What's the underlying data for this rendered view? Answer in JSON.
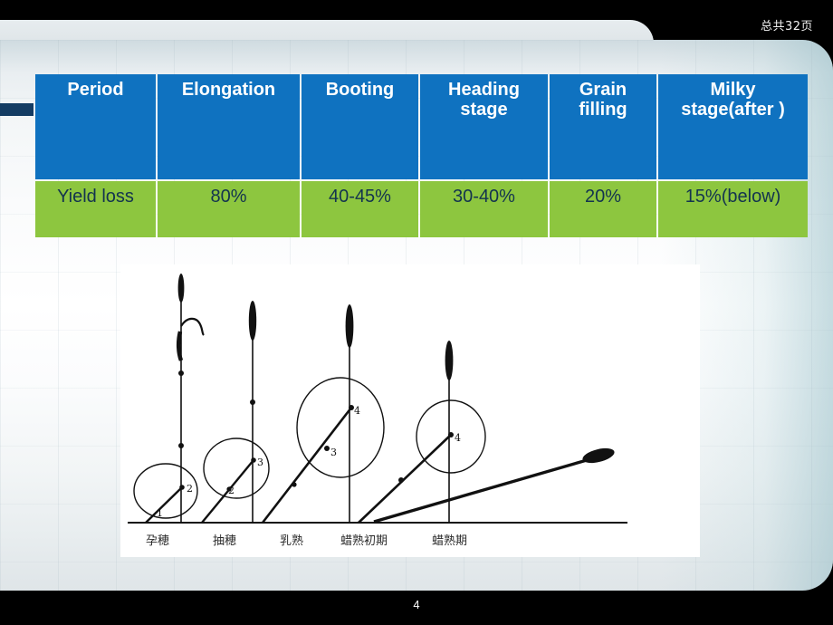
{
  "slide": {
    "page_counter": "总共32页",
    "page_number": "4",
    "accent_color": "#143c63",
    "header_color": "#0f72c0",
    "row_color": "#8dc63f",
    "row_text_color": "#13334f"
  },
  "table": {
    "headers": [
      "Period",
      "Elongation",
      "Booting",
      "Heading stage",
      "Grain filling",
      "Milky stage(after )"
    ],
    "rows": [
      {
        "label": "Yield loss",
        "values": [
          "80%",
          "40-45%",
          "30-40%",
          "20%",
          "15%(below)"
        ]
      }
    ]
  },
  "figure": {
    "name": "crop-lodging-growth-stage-diagram",
    "stage_labels": [
      "孕穂",
      "抽穂",
      "乳熟",
      "蜡熟初期",
      "蜡熟期"
    ],
    "node_numbers": [
      "1",
      "2",
      "2",
      "3",
      "3",
      "4",
      "4"
    ],
    "plants": [
      {
        "stage": "孕穂",
        "node_labels": [
          "1",
          "2"
        ],
        "circles": 1
      },
      {
        "stage": "抽穂",
        "node_labels": [
          "2",
          "3"
        ],
        "circles": 1
      },
      {
        "stage": "乳熟",
        "node_labels": [
          "3",
          "4"
        ],
        "circles": 1
      },
      {
        "stage": "蜡熟初期",
        "node_labels": [
          "4"
        ],
        "circles": 1
      },
      {
        "stage": "蜡熟期",
        "node_labels": [],
        "circles": 0
      }
    ]
  }
}
